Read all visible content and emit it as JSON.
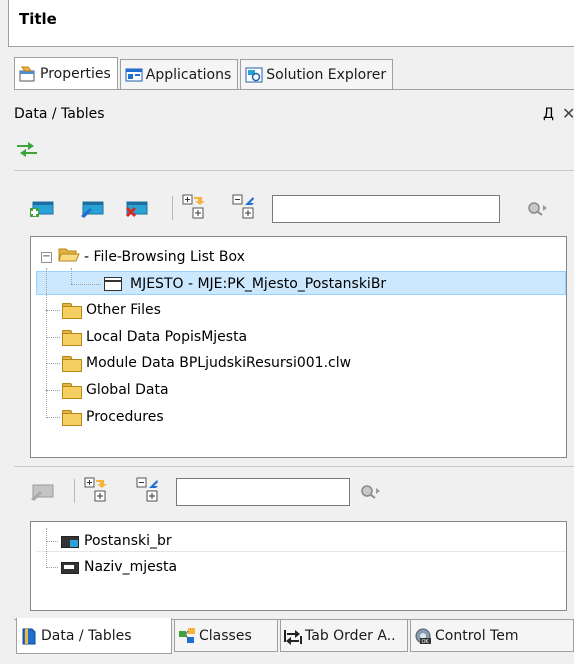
{
  "window": {
    "title": "Title"
  },
  "top_tabs": [
    {
      "label": "Properties",
      "icon": "properties-icon",
      "active": true
    },
    {
      "label": "Applications",
      "icon": "applications-icon",
      "active": false
    },
    {
      "label": "Solution Explorer",
      "icon": "solution-explorer-icon",
      "active": false
    }
  ],
  "panel": {
    "title": "Data / Tables",
    "pin_glyph": "Д",
    "close_glyph": "✕"
  },
  "upper_tree": {
    "nodes": [
      {
        "label": " - File-Browsing List Box",
        "icon": "folder-open-icon"
      },
      {
        "label": "MJESTO - MJE:PK_Mjesto_PostanskiBr",
        "icon": "table-icon",
        "selected": true
      },
      {
        "label": "Other Files",
        "icon": "folder-icon"
      },
      {
        "label": "Local Data PopisMjesta",
        "icon": "folder-icon"
      },
      {
        "label": "Module Data BPLjudskiResursi001.clw",
        "icon": "folder-icon"
      },
      {
        "label": "Global Data",
        "icon": "folder-icon"
      },
      {
        "label": "Procedures",
        "icon": "folder-icon"
      }
    ]
  },
  "lower_tree": {
    "nodes": [
      {
        "label": "Postanski_br",
        "icon": "key-field-icon"
      },
      {
        "label": "Naziv_mjesta",
        "icon": "field-icon"
      }
    ]
  },
  "bottom_tabs": [
    {
      "label": "Data / Tables",
      "icon": "data-tables-icon",
      "active": true
    },
    {
      "label": "Classes",
      "icon": "classes-icon",
      "active": false
    },
    {
      "label": "Tab Order A..",
      "icon": "tab-order-icon",
      "active": false
    },
    {
      "label": "Control Tem",
      "icon": "control-templates-icon",
      "active": false
    }
  ],
  "colors": {
    "selection": "#cce8ff",
    "selection_border": "#99d1ff",
    "folder": "#f5cf62",
    "accent_blue": "#1f6fd1"
  }
}
